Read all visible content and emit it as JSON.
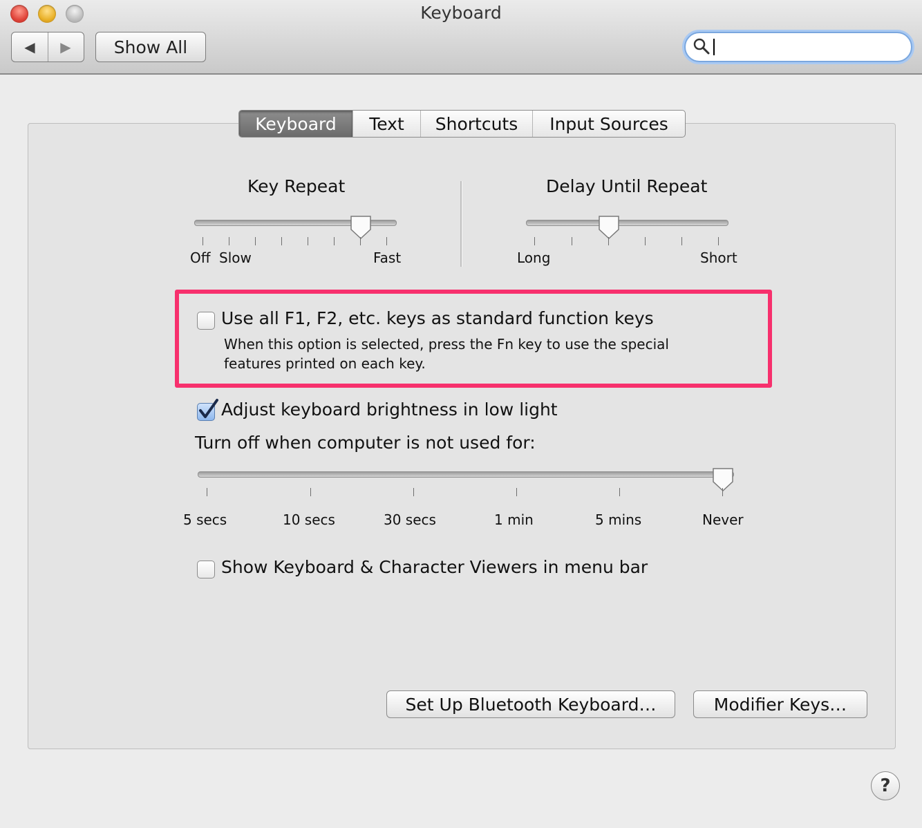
{
  "window": {
    "title": "Keyboard"
  },
  "toolbar": {
    "back_icon": "◀",
    "forward_icon": "▶",
    "show_all_label": "Show All",
    "search_value": ""
  },
  "tabs": [
    {
      "label": "Keyboard",
      "selected": true
    },
    {
      "label": "Text",
      "selected": false
    },
    {
      "label": "Shortcuts",
      "selected": false
    },
    {
      "label": "Input Sources",
      "selected": false
    }
  ],
  "key_repeat": {
    "title": "Key Repeat",
    "labels": {
      "off": "Off",
      "slow": "Slow",
      "fast": "Fast"
    },
    "value_fraction": 0.83
  },
  "delay_until_repeat": {
    "title": "Delay Until Repeat",
    "labels": {
      "long": "Long",
      "short": "Short"
    },
    "value_fraction": 0.4
  },
  "function_keys": {
    "checked": false,
    "label": "Use all F1, F2, etc. keys as standard function keys",
    "description_line1": "When this option is selected, press the Fn key to use the special",
    "description_line2": "features printed on each key."
  },
  "brightness": {
    "checked": true,
    "label": "Adjust keyboard brightness in low light"
  },
  "turn_off": {
    "label": "Turn off when computer is not used for:",
    "ticks": [
      "5 secs",
      "10 secs",
      "30 secs",
      "1 min",
      "5 mins",
      "Never"
    ],
    "selected": "Never"
  },
  "viewers": {
    "checked": false,
    "label": "Show Keyboard & Character Viewers in menu bar"
  },
  "buttons": {
    "bluetooth": "Set Up Bluetooth Keyboard…",
    "modifier": "Modifier Keys…",
    "help": "?"
  },
  "colors": {
    "highlight": "#f7306d",
    "selected_tab": "#7b7b7b"
  }
}
